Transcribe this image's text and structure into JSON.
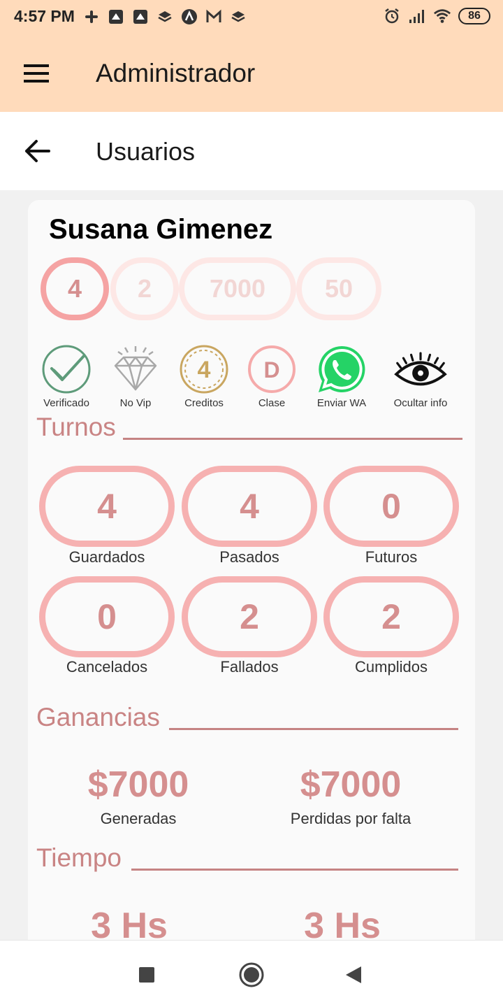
{
  "status": {
    "time": "4:57 PM",
    "battery": "86"
  },
  "appbar": {
    "title": "Administrador"
  },
  "subbar": {
    "title": "Usuarios"
  },
  "user": {
    "name": "Susana Gimenez",
    "pills": [
      "4",
      "2",
      "7000",
      "50"
    ]
  },
  "icons": [
    {
      "label": "Verificado",
      "icon": "check-circle-icon"
    },
    {
      "label": "No Vip",
      "icon": "diamond-icon"
    },
    {
      "label": "Creditos",
      "icon": "credits-coin-icon",
      "value": "4"
    },
    {
      "label": "Clase",
      "icon": "class-badge-icon",
      "value": "D"
    },
    {
      "label": "Enviar WA",
      "icon": "whatsapp-icon"
    },
    {
      "label": "Ocultar info",
      "icon": "eye-icon"
    }
  ],
  "turnos": {
    "title": "Turnos",
    "items": [
      {
        "value": "4",
        "label": "Guardados"
      },
      {
        "value": "4",
        "label": "Pasados"
      },
      {
        "value": "0",
        "label": "Futuros"
      },
      {
        "value": "0",
        "label": "Cancelados"
      },
      {
        "value": "2",
        "label": "Fallados"
      },
      {
        "value": "2",
        "label": "Cumplidos"
      }
    ]
  },
  "ganancias": {
    "title": "Ganancias",
    "items": [
      {
        "value": "$7000",
        "label": "Generadas"
      },
      {
        "value": "$7000",
        "label": "Perdidas por falta"
      }
    ]
  },
  "tiempo": {
    "title": "Tiempo",
    "items": [
      {
        "value": "3 Hs"
      },
      {
        "value": "3 Hs"
      }
    ]
  },
  "colors": {
    "header": "#ffdbbb",
    "accent": "#d58f8f",
    "pill_border": "#f6b1b1"
  }
}
